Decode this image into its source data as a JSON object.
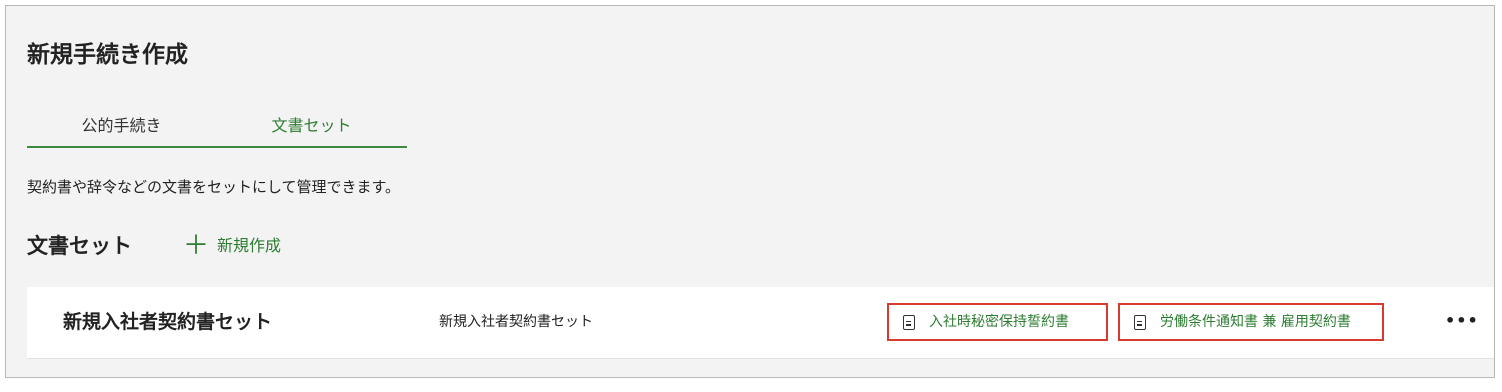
{
  "header": {
    "title": "新規手続き作成"
  },
  "tabs": [
    {
      "label": "公的手続き",
      "active": false
    },
    {
      "label": "文書セット",
      "active": true
    }
  ],
  "description": "契約書や辞令などの文書をセットにして管理できます。",
  "section": {
    "title": "文書セット",
    "new_button": {
      "icon": "plus-icon",
      "label": "新規作成"
    }
  },
  "document_sets": [
    {
      "name": "新規入社者契約書セット",
      "subtitle": "新規入社者契約書セット",
      "documents": [
        {
          "icon": "document-icon",
          "label": "入社時秘密保持誓約書"
        },
        {
          "icon": "document-icon",
          "label": "労働条件通知書 兼 雇用契約書"
        }
      ],
      "more_icon": "more-horizontal-icon",
      "more_label": "•••"
    }
  ],
  "colors": {
    "accent": "#2e7d32",
    "highlight_border": "#d93a30",
    "panel_bg": "#f3f3f3"
  }
}
